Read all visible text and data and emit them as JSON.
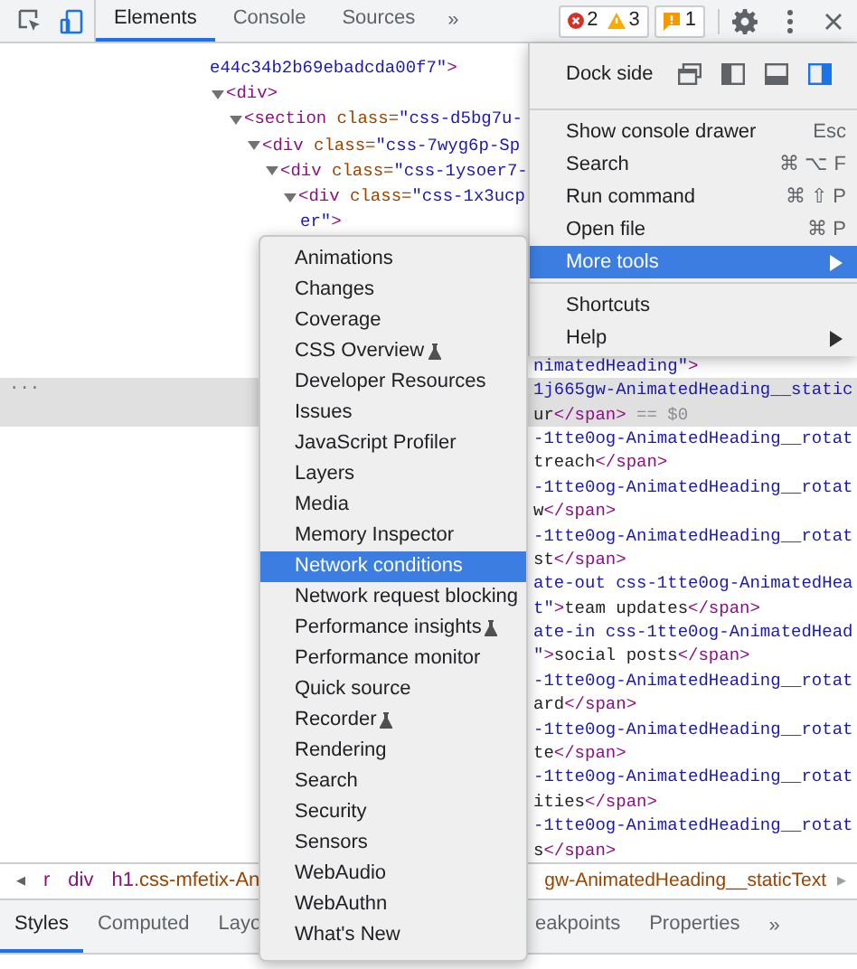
{
  "toolbar": {
    "tabs": [
      {
        "label": "Elements",
        "selected": true
      },
      {
        "label": "Console",
        "selected": false
      },
      {
        "label": "Sources",
        "selected": false
      }
    ],
    "overflow": "»",
    "errors": "2",
    "warnings": "3",
    "issues": "1"
  },
  "code": {
    "tree": [
      {
        "kind": "wrap",
        "tokens": [
          {
            "kind": "value",
            "text": "e44c34b2b69ebadcda00f7\""
          },
          {
            "kind": "tag",
            "text": ">"
          }
        ]
      },
      {
        "kind": "element",
        "expanded": true,
        "tokens": [
          {
            "kind": "tag",
            "text": "<div>"
          }
        ],
        "children": [
          {
            "kind": "element",
            "expanded": true,
            "tokens": [
              {
                "kind": "tag",
                "text": "<section"
              },
              {
                "kind": "attr",
                "text": " class="
              },
              {
                "kind": "value",
                "text": "\"css-d5bg7u-"
              }
            ],
            "children": [
              {
                "kind": "element",
                "expanded": true,
                "tokens": [
                  {
                    "kind": "tag",
                    "text": "<div"
                  },
                  {
                    "kind": "attr",
                    "text": " class="
                  },
                  {
                    "kind": "value",
                    "text": "\"css-7wyg6p-Sp"
                  }
                ],
                "children": [
                  {
                    "kind": "element",
                    "expanded": true,
                    "tokens": [
                      {
                        "kind": "tag",
                        "text": "<div"
                      },
                      {
                        "kind": "attr",
                        "text": " class="
                      },
                      {
                        "kind": "value",
                        "text": "\"css-1ysoer7-"
                      }
                    ],
                    "children": [
                      {
                        "kind": "element",
                        "expanded": true,
                        "tokens": [
                          {
                            "kind": "tag",
                            "text": "<div"
                          },
                          {
                            "kind": "attr",
                            "text": " class="
                          },
                          {
                            "kind": "value",
                            "text": "\"css-1x3ucp"
                          }
                        ],
                        "children": [
                          {
                            "kind": "wrap",
                            "tokens": [
                              {
                                "kind": "value",
                                "text": "er\""
                              },
                              {
                                "kind": "tag",
                                "text": ">"
                              }
                            ]
                          }
                        ]
                      }
                    ]
                  }
                ]
              }
            ]
          }
        ]
      }
    ],
    "selected_marker": "...",
    "fragments": [
      {
        "selected": false,
        "tokens": [
          {
            "kind": "value",
            "text": "nimatedHeading\""
          },
          {
            "kind": "tag",
            "text": ">"
          }
        ]
      },
      {
        "selected": true,
        "tokens": [
          {
            "kind": "value",
            "text": "1j665gw-AnimatedHeading__static"
          }
        ]
      },
      {
        "selected": true,
        "tokens": [
          {
            "kind": "text",
            "text": "ur"
          },
          {
            "kind": "tag",
            "text": "</span>"
          },
          {
            "kind": "muted",
            "text": " == $0"
          }
        ]
      },
      {
        "selected": false,
        "tokens": [
          {
            "kind": "value",
            "text": "-1tte0og-AnimatedHeading__rotat"
          }
        ]
      },
      {
        "selected": false,
        "tokens": [
          {
            "kind": "text",
            "text": "treach"
          },
          {
            "kind": "tag",
            "text": "</span>"
          }
        ]
      },
      {
        "selected": false,
        "tokens": [
          {
            "kind": "value",
            "text": "-1tte0og-AnimatedHeading__rotat"
          }
        ]
      },
      {
        "selected": false,
        "tokens": [
          {
            "kind": "text",
            "text": "w"
          },
          {
            "kind": "tag",
            "text": "</span>"
          }
        ]
      },
      {
        "selected": false,
        "tokens": [
          {
            "kind": "value",
            "text": "-1tte0og-AnimatedHeading__rotat"
          }
        ]
      },
      {
        "selected": false,
        "tokens": [
          {
            "kind": "text",
            "text": "st"
          },
          {
            "kind": "tag",
            "text": "</span>"
          }
        ]
      },
      {
        "selected": false,
        "tokens": [
          {
            "kind": "value",
            "text": "ate-out css-1tte0og-AnimatedHea"
          }
        ]
      },
      {
        "selected": false,
        "tokens": [
          {
            "kind": "value",
            "text": "t\""
          },
          {
            "kind": "tag",
            "text": ">"
          },
          {
            "kind": "text",
            "text": "team updates"
          },
          {
            "kind": "tag",
            "text": "</span>"
          }
        ]
      },
      {
        "selected": false,
        "tokens": [
          {
            "kind": "value",
            "text": "ate-in css-1tte0og-AnimatedHead"
          }
        ]
      },
      {
        "selected": false,
        "tokens": [
          {
            "kind": "value",
            "text": "\""
          },
          {
            "kind": "tag",
            "text": ">"
          },
          {
            "kind": "text",
            "text": "social posts"
          },
          {
            "kind": "tag",
            "text": "</span>"
          }
        ]
      },
      {
        "selected": false,
        "tokens": [
          {
            "kind": "value",
            "text": "-1tte0og-AnimatedHeading__rotat"
          }
        ]
      },
      {
        "selected": false,
        "tokens": [
          {
            "kind": "text",
            "text": "ard"
          },
          {
            "kind": "tag",
            "text": "</span>"
          }
        ]
      },
      {
        "selected": false,
        "tokens": [
          {
            "kind": "value",
            "text": "-1tte0og-AnimatedHeading__rotat"
          }
        ]
      },
      {
        "selected": false,
        "tokens": [
          {
            "kind": "text",
            "text": "te"
          },
          {
            "kind": "tag",
            "text": "</span>"
          }
        ]
      },
      {
        "selected": false,
        "tokens": [
          {
            "kind": "value",
            "text": "-1tte0og-AnimatedHeading__rotat"
          }
        ]
      },
      {
        "selected": false,
        "tokens": [
          {
            "kind": "text",
            "text": "ities"
          },
          {
            "kind": "tag",
            "text": "</span>"
          }
        ]
      },
      {
        "selected": false,
        "tokens": [
          {
            "kind": "value",
            "text": "-1tte0og-AnimatedHeading__rotat"
          }
        ]
      },
      {
        "selected": false,
        "tokens": [
          {
            "kind": "text",
            "text": "s"
          },
          {
            "kind": "tag",
            "text": "</span>"
          }
        ]
      }
    ]
  },
  "breadcrumbs": {
    "left_arrow": "◂",
    "left": [
      {
        "kind": "plain",
        "text": "r"
      },
      {
        "kind": "tag",
        "text": "div"
      },
      {
        "kind": "selector",
        "text": "h1.css-mfetix-An"
      }
    ],
    "right": {
      "text": "gw-AnimatedHeading__staticText"
    },
    "right_arrow": "▸"
  },
  "bottom_tabs": {
    "left": [
      {
        "label": "Styles",
        "selected": true
      },
      {
        "label": "Computed",
        "selected": false
      },
      {
        "label": "Layo",
        "selected": false
      }
    ],
    "right": [
      {
        "label": "eakpoints",
        "selected": false
      },
      {
        "label": "Properties",
        "selected": false
      }
    ],
    "overflow": "»"
  },
  "main_menu": {
    "dock_side": {
      "label": "Dock side",
      "options": [
        {
          "kind": "undock",
          "selected": false
        },
        {
          "kind": "left",
          "selected": false
        },
        {
          "kind": "bottom",
          "selected": false
        },
        {
          "kind": "right",
          "selected": true
        }
      ]
    },
    "groups": [
      [
        {
          "label": "Show console drawer",
          "shortcut": "Esc",
          "submenu": false,
          "selected": false
        },
        {
          "label": "Search",
          "shortcut": "⌘ ⌥ F",
          "submenu": false,
          "selected": false
        },
        {
          "label": "Run command",
          "shortcut": "⌘ ⇧ P",
          "submenu": false,
          "selected": false
        },
        {
          "label": "Open file",
          "shortcut": "⌘ P",
          "submenu": false,
          "selected": false
        },
        {
          "label": "More tools",
          "submenu": true,
          "selected": true
        }
      ],
      [
        {
          "label": "Shortcuts",
          "submenu": false,
          "selected": false
        },
        {
          "label": "Help",
          "submenu": true,
          "selected": false
        }
      ]
    ]
  },
  "more_tools_menu": {
    "items": [
      {
        "label": "Animations",
        "experimental": false,
        "selected": false
      },
      {
        "label": "Changes",
        "experimental": false,
        "selected": false
      },
      {
        "label": "Coverage",
        "experimental": false,
        "selected": false
      },
      {
        "label": "CSS Overview",
        "experimental": true,
        "selected": false
      },
      {
        "label": "Developer Resources",
        "experimental": false,
        "selected": false
      },
      {
        "label": "Issues",
        "experimental": false,
        "selected": false
      },
      {
        "label": "JavaScript Profiler",
        "experimental": false,
        "selected": false
      },
      {
        "label": "Layers",
        "experimental": false,
        "selected": false
      },
      {
        "label": "Media",
        "experimental": false,
        "selected": false
      },
      {
        "label": "Memory Inspector",
        "experimental": false,
        "selected": false
      },
      {
        "label": "Network conditions",
        "experimental": false,
        "selected": true
      },
      {
        "label": "Network request blocking",
        "experimental": false,
        "selected": false
      },
      {
        "label": "Performance insights",
        "experimental": true,
        "selected": false
      },
      {
        "label": "Performance monitor",
        "experimental": false,
        "selected": false
      },
      {
        "label": "Quick source",
        "experimental": false,
        "selected": false
      },
      {
        "label": "Recorder",
        "experimental": true,
        "selected": false
      },
      {
        "label": "Rendering",
        "experimental": false,
        "selected": false
      },
      {
        "label": "Search",
        "experimental": false,
        "selected": false
      },
      {
        "label": "Security",
        "experimental": false,
        "selected": false
      },
      {
        "label": "Sensors",
        "experimental": false,
        "selected": false
      },
      {
        "label": "WebAudio",
        "experimental": false,
        "selected": false
      },
      {
        "label": "WebAuthn",
        "experimental": false,
        "selected": false
      },
      {
        "label": "What's New",
        "experimental": false,
        "selected": false
      }
    ]
  }
}
